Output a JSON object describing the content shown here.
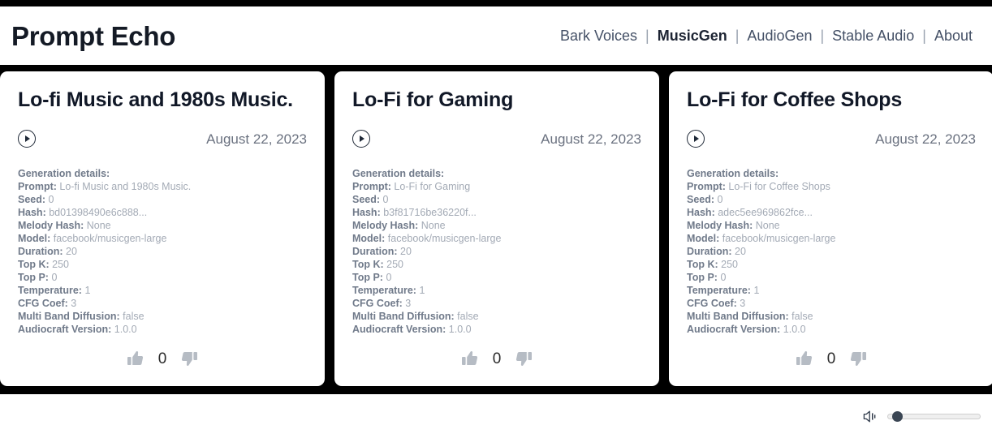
{
  "header": {
    "brand": "Prompt Echo",
    "nav": [
      {
        "label": "Bark Voices",
        "active": false
      },
      {
        "label": "MusicGen",
        "active": true
      },
      {
        "label": "AudioGen",
        "active": false
      },
      {
        "label": "Stable Audio",
        "active": false
      },
      {
        "label": "About",
        "active": false
      }
    ],
    "separator": "|"
  },
  "labels": {
    "generation_details": "Generation details:",
    "prompt": "Prompt:",
    "seed": "Seed:",
    "hash": "Hash:",
    "melody_hash": "Melody Hash:",
    "model": "Model:",
    "duration": "Duration:",
    "top_k": "Top K:",
    "top_p": "Top P:",
    "temperature": "Temperature:",
    "cfg_coef": "CFG Coef:",
    "multi_band_diffusion": "Multi Band Diffusion:",
    "audiocraft_version": "Audiocraft Version:"
  },
  "icons": {
    "play": "play-icon",
    "thumbs_up": "thumbs-up-icon",
    "thumbs_down": "thumbs-down-icon",
    "speaker": "speaker-icon"
  },
  "cards": [
    {
      "title": "Lo-fi Music and 1980s Music.",
      "date": "August 22, 2023",
      "prompt": "Lo-fi Music and 1980s Music.",
      "seed": "0",
      "hash": "bd01398490e6c888...",
      "melody_hash": "None",
      "model": "facebook/musicgen-large",
      "duration": "20",
      "top_k": "250",
      "top_p": "0",
      "temperature": "1",
      "cfg_coef": "3",
      "multi_band_diffusion": "false",
      "audiocraft_version": "1.0.0",
      "vote_count": "0"
    },
    {
      "title": "Lo-Fi for Gaming",
      "date": "August 22, 2023",
      "prompt": "Lo-Fi for Gaming",
      "seed": "0",
      "hash": "b3f81716be36220f...",
      "melody_hash": "None",
      "model": "facebook/musicgen-large",
      "duration": "20",
      "top_k": "250",
      "top_p": "0",
      "temperature": "1",
      "cfg_coef": "3",
      "multi_band_diffusion": "false",
      "audiocraft_version": "1.0.0",
      "vote_count": "0"
    },
    {
      "title": "Lo-Fi for Coffee Shops",
      "date": "August 22, 2023",
      "prompt": "Lo-Fi for Coffee Shops",
      "seed": "0",
      "hash": "adec5ee969862fce...",
      "melody_hash": "None",
      "model": "facebook/musicgen-large",
      "duration": "20",
      "top_k": "250",
      "top_p": "0",
      "temperature": "1",
      "cfg_coef": "3",
      "multi_band_diffusion": "false",
      "audiocraft_version": "1.0.0",
      "vote_count": "0"
    }
  ],
  "player": {
    "volume_percent": 3
  },
  "colors": {
    "page_background": "#000000",
    "surface": "#ffffff",
    "brand_text": "#141a25",
    "nav_text": "#445066",
    "nav_active_text": "#1d2433",
    "detail_label": "#707a8a",
    "detail_value": "#a3aab5",
    "date_text": "#6b7280",
    "vote_icon": "#b6bcc4",
    "slider_thumb": "#3b4654"
  }
}
